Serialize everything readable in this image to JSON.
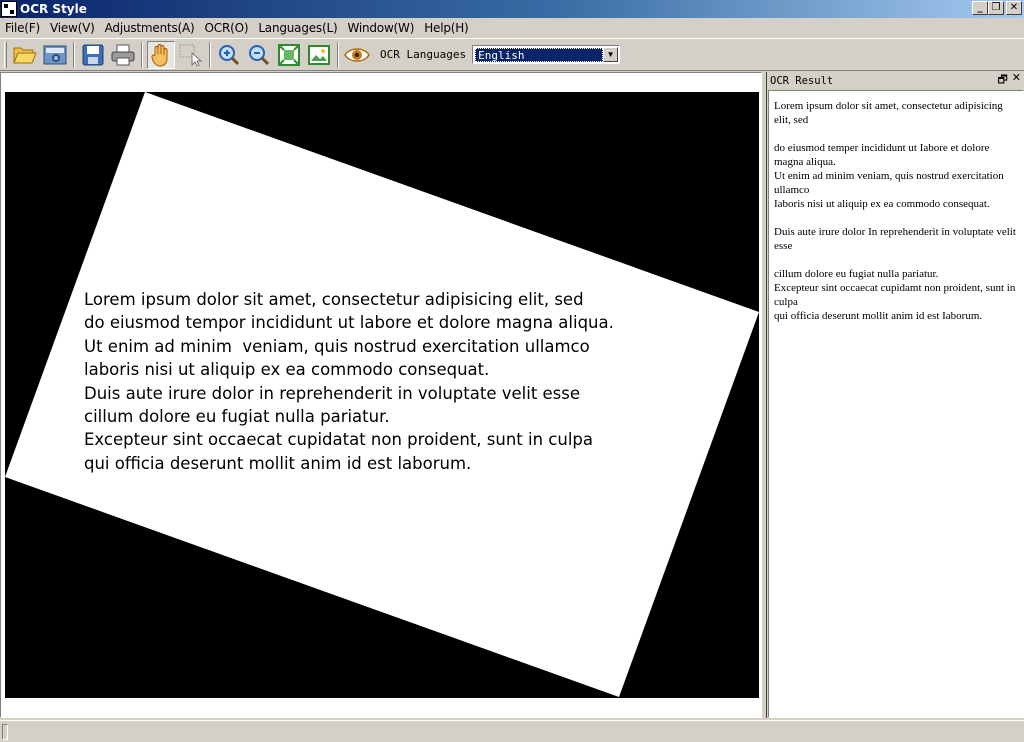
{
  "window": {
    "title": "OCR Style"
  },
  "window_controls": {
    "minimize": "_",
    "restore": "❐",
    "close": "✕"
  },
  "menu": [
    "File(F)",
    "View(V)",
    "Adjustments(A)",
    "OCR(O)",
    "Languages(L)",
    "Window(W)",
    "Help(H)"
  ],
  "toolbar": {
    "ocr_languages_label": "OCR Languages",
    "language_selected": "English",
    "icons": [
      "open-folder-icon",
      "scan-icon",
      "save-icon",
      "print-icon",
      "hand-pan-icon",
      "select-pointer-icon",
      "zoom-in-icon",
      "zoom-out-icon",
      "fit-window-icon",
      "actual-size-icon",
      "eye-icon"
    ]
  },
  "image_document": {
    "lines": [
      "Lorem ipsum dolor sit amet, consectetur adipisicing elit, sed",
      "do eiusmod tempor incididunt ut labore et dolore magna aliqua.",
      "Ut enim ad minim  veniam, quis nostrud exercitation ullamco",
      "laboris nisi ut aliquip ex ea commodo consequat.",
      "Duis aute irure dolor in reprehenderit in voluptate velit esse",
      "cillum dolore eu fugiat nulla pariatur.",
      "Excepteur sint occaecat cupidatat non proident, sunt in culpa",
      "qui officia deserunt mollit anim id est laborum."
    ]
  },
  "result_panel": {
    "title": "OCR Result",
    "float_symbol": "🗗",
    "close_symbol": "✕",
    "text": "Lorem ipsum dolor sit amet, consectetur adipisicing elit, sed\n\ndo eiusmod temper incididunt ut Iabore et dolore magna aliqua.\nUt enim ad minim veniam, quis nostrud exercitation ullamco\nIaboris nisi ut aliquip ex ea commodo consequat.\n\nDuis aute irure dolor In reprehenderit in voluptate velit esse\n\ncillum dolore eu fugiat nulla pariatur.\nExcepteur sint occaecat cupidamt non proident, sunt in culpa\nqui officia deserunt mollit anim id est Iaborum."
  }
}
